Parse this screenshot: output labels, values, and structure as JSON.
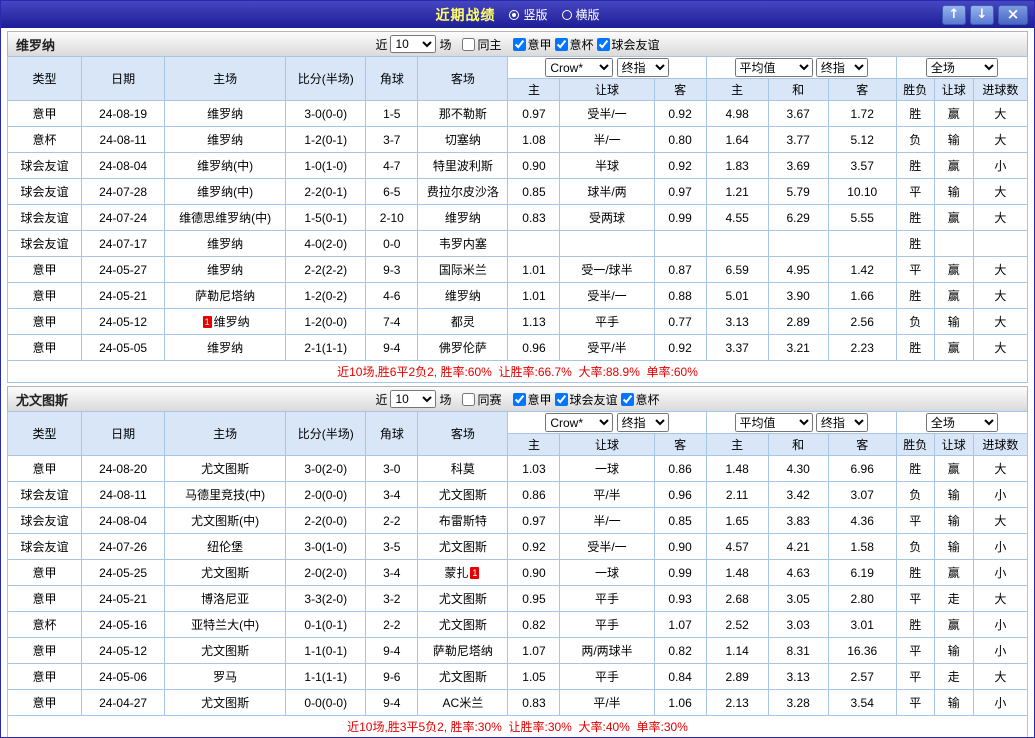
{
  "palette": {
    "titlebar_bg": "#2a2aa0",
    "serie_a_bg": "#1f6de0",
    "cup_bg": "#4133d1",
    "friendly_bg": "#17a3ae",
    "focus_team_green": "#008000",
    "result_red": "#e60000",
    "result_green": "#008000",
    "result_blue": "#2121d4",
    "header_bg": "#d8e6f8",
    "grid_border": "#a6c6e6"
  },
  "titlebar": {
    "title": "近期战绩",
    "view_options": [
      {
        "label": "竖版",
        "selected": true
      },
      {
        "label": "横版",
        "selected": false
      }
    ],
    "up_button": "↑",
    "down_button": "↓",
    "close_button": "×"
  },
  "table_header": {
    "cols": [
      "类型",
      "日期",
      "主场",
      "比分(半场)",
      "角球",
      "客场"
    ],
    "sub": [
      "主",
      "让球",
      "客",
      "主",
      "和",
      "客",
      "胜负",
      "让球",
      "进球数"
    ],
    "bookmaker_select": "Crow*",
    "final_select1": "终指",
    "average_select": "平均值",
    "final_select2": "终指",
    "scope_select": "全场"
  },
  "sections": [
    {
      "team": "维罗纳",
      "filter": {
        "near_label": "近",
        "count": "10",
        "games_label": "场",
        "checkboxes": [
          {
            "label": "同主",
            "checked": false
          },
          {
            "label": "意甲",
            "checked": true
          },
          {
            "label": "意杯",
            "checked": true
          },
          {
            "label": "球会友谊",
            "checked": true
          }
        ]
      },
      "rows": [
        {
          "type": "意甲",
          "league": "serieA",
          "date": "24-08-19",
          "home": "维罗纳",
          "home_focus": true,
          "home_card": "",
          "score": "3-0(0-0)",
          "score_color": "red",
          "corner": "1-5",
          "away": "那不勒斯",
          "away_focus": false,
          "away_card": "",
          "o1": "0.97",
          "handicap": "受半/一",
          "o2": "0.92",
          "a1": "4.98",
          "a2": "3.67",
          "a3": "1.72",
          "r1": "胜",
          "r1c": "red",
          "r2": "赢",
          "r2c": "red",
          "r3": "大",
          "r3c": "red"
        },
        {
          "type": "意杯",
          "league": "cup",
          "date": "24-08-11",
          "home": "维罗纳",
          "home_focus": true,
          "home_card": "",
          "score": "1-2(0-1)",
          "score_color": "red",
          "corner": "3-7",
          "away": "切塞纳",
          "away_focus": false,
          "away_card": "",
          "o1": "1.08",
          "handicap": "半/一",
          "o2": "0.80",
          "a1": "1.64",
          "a2": "3.77",
          "a3": "5.12",
          "r1": "负",
          "r1c": "green",
          "r2": "输",
          "r2c": "blue",
          "r3": "大",
          "r3c": "red"
        },
        {
          "type": "球会友谊",
          "league": "friendly",
          "date": "24-08-04",
          "home": "维罗纳(中)",
          "home_focus": true,
          "home_card": "",
          "score": "1-0(1-0)",
          "score_color": "red",
          "corner": "4-7",
          "away": "特里波利斯",
          "away_focus": false,
          "away_card": "",
          "o1": "0.90",
          "handicap": "半球",
          "o2": "0.92",
          "a1": "1.83",
          "a2": "3.69",
          "a3": "3.57",
          "r1": "胜",
          "r1c": "red",
          "r2": "赢",
          "r2c": "red",
          "r3": "小",
          "r3c": "blue"
        },
        {
          "type": "球会友谊",
          "league": "friendly",
          "date": "24-07-28",
          "home": "维罗纳(中)",
          "home_focus": true,
          "home_card": "",
          "score": "2-2(0-1)",
          "score_color": "red",
          "corner": "6-5",
          "away": "费拉尔皮沙洛",
          "away_focus": false,
          "away_card": "",
          "o1": "0.85",
          "handicap": "球半/两",
          "o2": "0.97",
          "a1": "1.21",
          "a2": "5.79",
          "a3": "10.10",
          "r1": "平",
          "r1c": "green",
          "r2": "输",
          "r2c": "blue",
          "r3": "大",
          "r3c": "red"
        },
        {
          "type": "球会友谊",
          "league": "friendly",
          "date": "24-07-24",
          "home": "维德思维罗纳(中)",
          "home_focus": false,
          "home_card": "",
          "score": "1-5(0-1)",
          "score_color": "red",
          "corner": "2-10",
          "away": "维罗纳",
          "away_focus": true,
          "away_card": "",
          "o1": "0.83",
          "handicap": "受两球",
          "o2": "0.99",
          "a1": "4.55",
          "a2": "6.29",
          "a3": "5.55",
          "r1": "胜",
          "r1c": "red",
          "r2": "赢",
          "r2c": "red",
          "r3": "大",
          "r3c": "red"
        },
        {
          "type": "球会友谊",
          "league": "friendly",
          "date": "24-07-17",
          "home": "维罗纳",
          "home_focus": true,
          "home_card": "",
          "score": "4-0(2-0)",
          "score_color": "red",
          "corner": "0-0",
          "away": "韦罗内塞",
          "away_focus": false,
          "away_card": "",
          "o1": "",
          "handicap": "",
          "o2": "",
          "a1": "",
          "a2": "",
          "a3": "",
          "r1": "胜",
          "r1c": "red",
          "r2": "",
          "r2c": "",
          "r3": "",
          "r3c": ""
        },
        {
          "type": "意甲",
          "league": "serieA",
          "date": "24-05-27",
          "home": "维罗纳",
          "home_focus": true,
          "home_card": "",
          "score": "2-2(2-2)",
          "score_color": "red",
          "corner": "9-3",
          "away": "国际米兰",
          "away_focus": false,
          "away_card": "",
          "o1": "1.01",
          "handicap": "受一/球半",
          "o2": "0.87",
          "a1": "6.59",
          "a2": "4.95",
          "a3": "1.42",
          "r1": "平",
          "r1c": "green",
          "r2": "赢",
          "r2c": "red",
          "r3": "大",
          "r3c": "red"
        },
        {
          "type": "意甲",
          "league": "serieA",
          "date": "24-05-21",
          "home": "萨勒尼塔纳",
          "home_focus": false,
          "home_card": "",
          "score": "1-2(0-2)",
          "score_color": "red",
          "corner": "4-6",
          "away": "维罗纳",
          "away_focus": true,
          "away_card": "",
          "o1": "1.01",
          "handicap": "受半/一",
          "o2": "0.88",
          "a1": "5.01",
          "a2": "3.90",
          "a3": "1.66",
          "r1": "胜",
          "r1c": "red",
          "r2": "赢",
          "r2c": "red",
          "r3": "大",
          "r3c": "red"
        },
        {
          "type": "意甲",
          "league": "serieA",
          "date": "24-05-12",
          "home": "维罗纳",
          "home_focus": true,
          "home_card": "1",
          "score": "1-2(0-0)",
          "score_color": "red",
          "corner": "7-4",
          "away": "都灵",
          "away_focus": false,
          "away_card": "",
          "o1": "1.13",
          "handicap": "平手",
          "o2": "0.77",
          "a1": "3.13",
          "a2": "2.89",
          "a3": "2.56",
          "r1": "负",
          "r1c": "green",
          "r2": "输",
          "r2c": "blue",
          "r3": "大",
          "r3c": "red"
        },
        {
          "type": "意甲",
          "league": "serieA",
          "date": "24-05-05",
          "home": "维罗纳",
          "home_focus": true,
          "home_card": "",
          "score": "2-1(1-1)",
          "score_color": "red",
          "corner": "9-4",
          "away": "佛罗伦萨",
          "away_focus": false,
          "away_card": "",
          "o1": "0.96",
          "handicap": "受平/半",
          "o2": "0.92",
          "a1": "3.37",
          "a2": "3.21",
          "a3": "2.23",
          "r1": "胜",
          "r1c": "red",
          "r2": "赢",
          "r2c": "red",
          "r3": "大",
          "r3c": "red"
        }
      ],
      "footer": "近10场,胜6平2负2, 胜率:60%  让胜率:66.7%  大率:88.9%  单率:60%"
    },
    {
      "team": "尤文图斯",
      "filter": {
        "near_label": "近",
        "count": "10",
        "games_label": "场",
        "checkboxes": [
          {
            "label": "同赛",
            "checked": false
          },
          {
            "label": "意甲",
            "checked": true
          },
          {
            "label": "球会友谊",
            "checked": true
          },
          {
            "label": "意杯",
            "checked": true
          }
        ]
      },
      "rows": [
        {
          "type": "意甲",
          "league": "serieA",
          "date": "24-08-20",
          "home": "尤文图斯",
          "home_focus": true,
          "home_card": "",
          "score": "3-0(2-0)",
          "score_color": "red",
          "corner": "3-0",
          "away": "科莫",
          "away_focus": false,
          "away_card": "",
          "o1": "1.03",
          "handicap": "一球",
          "o2": "0.86",
          "a1": "1.48",
          "a2": "4.30",
          "a3": "6.96",
          "r1": "胜",
          "r1c": "red",
          "r2": "赢",
          "r2c": "red",
          "r3": "大",
          "r3c": "red"
        },
        {
          "type": "球会友谊",
          "league": "friendly",
          "date": "24-08-11",
          "home": "马德里竞技(中)",
          "home_focus": false,
          "home_card": "",
          "score": "2-0(0-0)",
          "score_color": "red",
          "corner": "3-4",
          "away": "尤文图斯",
          "away_focus": true,
          "away_card": "",
          "o1": "0.86",
          "handicap": "平/半",
          "o2": "0.96",
          "a1": "2.11",
          "a2": "3.42",
          "a3": "3.07",
          "r1": "负",
          "r1c": "green",
          "r2": "输",
          "r2c": "blue",
          "r3": "小",
          "r3c": "blue"
        },
        {
          "type": "球会友谊",
          "league": "friendly",
          "date": "24-08-04",
          "home": "尤文图斯(中)",
          "home_focus": true,
          "home_card": "",
          "score": "2-2(0-0)",
          "score_color": "red",
          "corner": "2-2",
          "away": "布雷斯特",
          "away_focus": false,
          "away_card": "",
          "o1": "0.97",
          "handicap": "半/一",
          "o2": "0.85",
          "a1": "1.65",
          "a2": "3.83",
          "a3": "4.36",
          "r1": "平",
          "r1c": "green",
          "r2": "输",
          "r2c": "blue",
          "r3": "大",
          "r3c": "red"
        },
        {
          "type": "球会友谊",
          "league": "friendly",
          "date": "24-07-26",
          "home": "纽伦堡",
          "home_focus": false,
          "home_card": "",
          "score": "3-0(1-0)",
          "score_color": "red",
          "corner": "3-5",
          "away": "尤文图斯",
          "away_focus": true,
          "away_card": "",
          "o1": "0.92",
          "handicap": "受半/一",
          "o2": "0.90",
          "a1": "4.57",
          "a2": "4.21",
          "a3": "1.58",
          "r1": "负",
          "r1c": "green",
          "r2": "输",
          "r2c": "blue",
          "r3": "小",
          "r3c": "blue"
        },
        {
          "type": "意甲",
          "league": "serieA",
          "date": "24-05-25",
          "home": "尤文图斯",
          "home_focus": true,
          "home_card": "",
          "score": "2-0(2-0)",
          "score_color": "red",
          "corner": "3-4",
          "away": "蒙扎",
          "away_focus": false,
          "away_card": "1",
          "o1": "0.90",
          "handicap": "一球",
          "o2": "0.99",
          "a1": "1.48",
          "a2": "4.63",
          "a3": "6.19",
          "r1": "胜",
          "r1c": "red",
          "r2": "赢",
          "r2c": "red",
          "r3": "小",
          "r3c": "blue"
        },
        {
          "type": "意甲",
          "league": "serieA",
          "date": "24-05-21",
          "home": "博洛尼亚",
          "home_focus": false,
          "home_card": "",
          "score": "3-3(2-0)",
          "score_color": "red",
          "corner": "3-2",
          "away": "尤文图斯",
          "away_focus": true,
          "away_card": "",
          "o1": "0.95",
          "handicap": "平手",
          "o2": "0.93",
          "a1": "2.68",
          "a2": "3.05",
          "a3": "2.80",
          "r1": "平",
          "r1c": "green",
          "r2": "走",
          "r2c": "green",
          "r3": "大",
          "r3c": "red"
        },
        {
          "type": "意杯",
          "league": "cup",
          "date": "24-05-16",
          "home": "亚特兰大(中)",
          "home_focus": false,
          "home_card": "",
          "score": "0-1(0-1)",
          "score_color": "red",
          "corner": "2-2",
          "away": "尤文图斯",
          "away_focus": true,
          "away_card": "",
          "o1": "0.82",
          "handicap": "平手",
          "o2": "1.07",
          "a1": "2.52",
          "a2": "3.03",
          "a3": "3.01",
          "r1": "胜",
          "r1c": "red",
          "r2": "赢",
          "r2c": "red",
          "r3": "小",
          "r3c": "blue"
        },
        {
          "type": "意甲",
          "league": "serieA",
          "date": "24-05-12",
          "home": "尤文图斯",
          "home_focus": true,
          "home_card": "",
          "score": "1-1(0-1)",
          "score_color": "red",
          "corner": "9-4",
          "away": "萨勒尼塔纳",
          "away_focus": false,
          "away_card": "",
          "o1": "1.07",
          "handicap": "两/两球半",
          "o2": "0.82",
          "a1": "1.14",
          "a2": "8.31",
          "a3": "16.36",
          "r1": "平",
          "r1c": "green",
          "r2": "输",
          "r2c": "blue",
          "r3": "小",
          "r3c": "blue"
        },
        {
          "type": "意甲",
          "league": "serieA",
          "date": "24-05-06",
          "home": "罗马",
          "home_focus": false,
          "home_card": "",
          "score": "1-1(1-1)",
          "score_color": "red",
          "corner": "9-6",
          "away": "尤文图斯",
          "away_focus": true,
          "away_card": "",
          "o1": "1.05",
          "handicap": "平手",
          "o2": "0.84",
          "a1": "2.89",
          "a2": "3.13",
          "a3": "2.57",
          "r1": "平",
          "r1c": "green",
          "r2": "走",
          "r2c": "green",
          "r3": "大",
          "r3c": "red"
        },
        {
          "type": "意甲",
          "league": "serieA",
          "date": "24-04-27",
          "home": "尤文图斯",
          "home_focus": true,
          "home_card": "",
          "score": "0-0(0-0)",
          "score_color": "blue",
          "corner": "9-4",
          "away": "AC米兰",
          "away_focus": false,
          "away_card": "",
          "o1": "0.83",
          "handicap": "平/半",
          "o2": "1.06",
          "a1": "2.13",
          "a2": "3.28",
          "a3": "3.54",
          "r1": "平",
          "r1c": "green",
          "r2": "输",
          "r2c": "blue",
          "r3": "小",
          "r3c": "blue"
        }
      ],
      "footer": "近10场,胜3平5负2, 胜率:30%  让胜率:30%  大率:40%  单率:30%"
    }
  ]
}
